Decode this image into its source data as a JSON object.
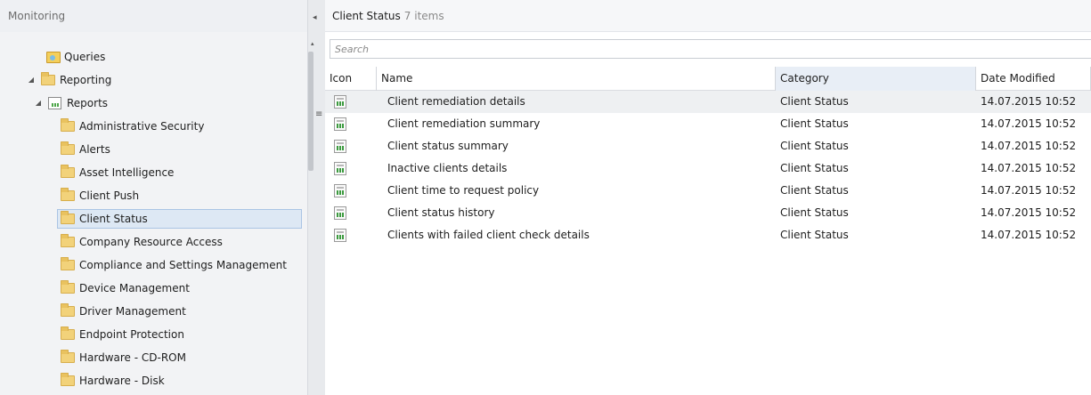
{
  "nav": {
    "title": "Monitoring",
    "tree": [
      {
        "label": "Queries",
        "level": 1,
        "icon": "query-icon",
        "arrow": "",
        "selected": false
      },
      {
        "label": "Reporting",
        "level": 0,
        "icon": "folder-icon",
        "arrow": "◢",
        "selected": false
      },
      {
        "label": "Reports",
        "level": 1,
        "icon": "report-icon",
        "arrow": "◢",
        "selected": false
      },
      {
        "label": "Administrative Security",
        "level": 2,
        "icon": "folder-icon",
        "arrow": "",
        "selected": false
      },
      {
        "label": "Alerts",
        "level": 2,
        "icon": "folder-icon",
        "arrow": "",
        "selected": false
      },
      {
        "label": "Asset Intelligence",
        "level": 2,
        "icon": "folder-icon",
        "arrow": "",
        "selected": false
      },
      {
        "label": "Client Push",
        "level": 2,
        "icon": "folder-icon",
        "arrow": "",
        "selected": false
      },
      {
        "label": "Client Status",
        "level": 2,
        "icon": "folder-icon",
        "arrow": "",
        "selected": true
      },
      {
        "label": "Company Resource Access",
        "level": 2,
        "icon": "folder-icon",
        "arrow": "",
        "selected": false
      },
      {
        "label": "Compliance and Settings Management",
        "level": 2,
        "icon": "folder-icon",
        "arrow": "",
        "selected": false
      },
      {
        "label": "Device Management",
        "level": 2,
        "icon": "folder-icon",
        "arrow": "",
        "selected": false
      },
      {
        "label": "Driver Management",
        "level": 2,
        "icon": "folder-icon",
        "arrow": "",
        "selected": false
      },
      {
        "label": "Endpoint Protection",
        "level": 2,
        "icon": "folder-icon",
        "arrow": "",
        "selected": false
      },
      {
        "label": "Hardware - CD-ROM",
        "level": 2,
        "icon": "folder-icon",
        "arrow": "",
        "selected": false
      },
      {
        "label": "Hardware - Disk",
        "level": 2,
        "icon": "folder-icon",
        "arrow": "",
        "selected": false
      }
    ]
  },
  "splitter": {
    "collapse_glyph": "◂",
    "scroll_up_glyph": "▴",
    "grip_glyph": "≡"
  },
  "content": {
    "title": "Client Status",
    "count": "7 items",
    "search_placeholder": "Search",
    "columns": [
      {
        "label": "Icon",
        "key": "icon"
      },
      {
        "label": "Name",
        "key": "name"
      },
      {
        "label": "Category",
        "key": "category",
        "sorted": true
      },
      {
        "label": "Date Modified",
        "key": "date"
      }
    ],
    "rows": [
      {
        "name": "Client remediation details",
        "category": "Client Status",
        "date": "14.07.2015 10:52"
      },
      {
        "name": "Client remediation summary",
        "category": "Client Status",
        "date": "14.07.2015 10:52"
      },
      {
        "name": "Client status summary",
        "category": "Client Status",
        "date": "14.07.2015 10:52"
      },
      {
        "name": "Inactive clients details",
        "category": "Client Status",
        "date": "14.07.2015 10:52"
      },
      {
        "name": "Client time to request policy",
        "category": "Client Status",
        "date": "14.07.2015 10:52"
      },
      {
        "name": "Client status history",
        "category": "Client Status",
        "date": "14.07.2015 10:52"
      },
      {
        "name": "Clients with failed client check details",
        "category": "Client Status",
        "date": "14.07.2015 10:52"
      }
    ]
  },
  "colors": {
    "nav_bg": "#f2f3f5",
    "selection_bg": "#dde8f4",
    "selection_border": "#aac4e4",
    "folder": "#f2d27a"
  }
}
